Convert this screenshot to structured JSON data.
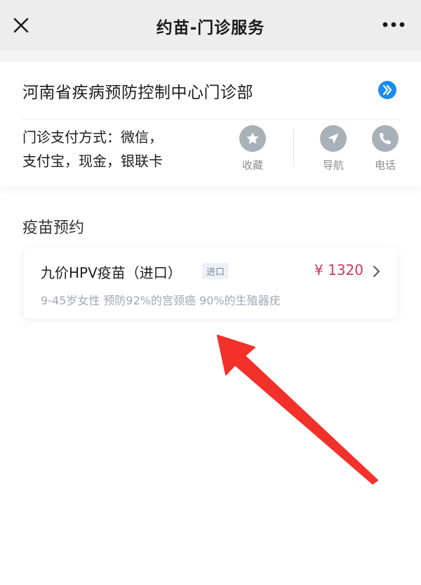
{
  "header": {
    "title": "约苗-门诊服务"
  },
  "clinic": {
    "name": "河南省疾病预防控制中心门诊部",
    "payment_line1": "门诊支付方式：微信，",
    "payment_line2": "支付宝，现金，银联卡"
  },
  "actions": {
    "favorite_label": "收藏",
    "navigate_label": "导航",
    "phone_label": "电话"
  },
  "section": {
    "title": "疫苗预约"
  },
  "vaccines": [
    {
      "name": "九价HPV疫苗（进口）",
      "badge": "进口",
      "price": "¥ 1320",
      "description": "9-45岁女性 预防92%的宫颈癌 90%的生殖器疣"
    }
  ],
  "colors": {
    "price": "#cc3b5b",
    "clinic_go": "#1a8cf0",
    "action_icon_bg": "#a8b0b8",
    "annotation_arrow": "#f2312b"
  },
  "icons": {
    "close": "close-icon",
    "more": "more-icon",
    "go": "chevron-right-circle-icon",
    "favorite": "star-icon",
    "navigate": "navigation-arrow-icon",
    "phone": "phone-icon",
    "chevron": "chevron-right-icon"
  }
}
